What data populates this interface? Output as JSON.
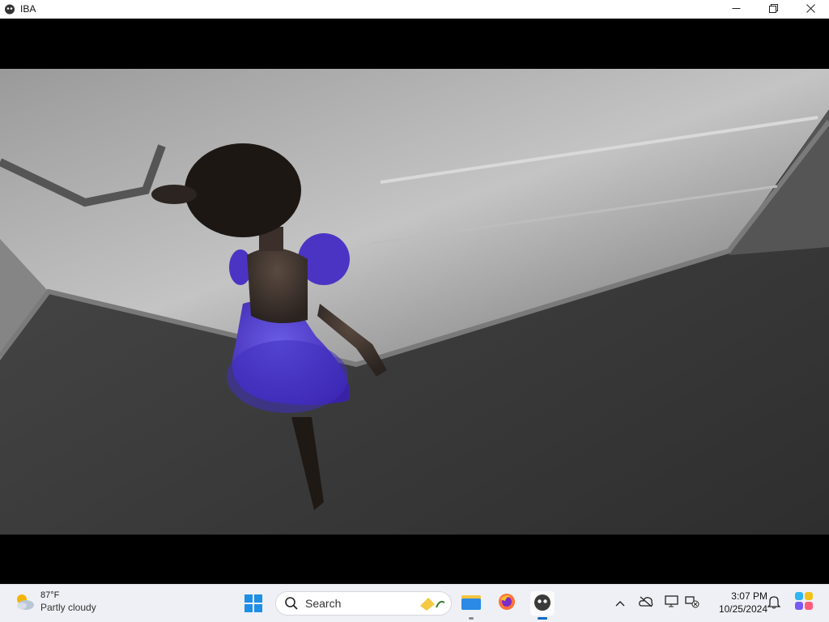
{
  "window": {
    "title": "IBA",
    "icon": "blob-face-icon",
    "controls": [
      "minimize-icon",
      "restore-icon",
      "close-icon"
    ]
  },
  "game": {
    "scene": "3D character in purple dress standing in grey room corner"
  },
  "taskbar": {
    "weather": {
      "temp": "87°F",
      "desc": "Partly cloudy",
      "icon": "partly-cloudy-icon"
    },
    "search": {
      "label": "Search"
    },
    "apps": [
      "file-explorer-icon",
      "firefox-icon",
      "iba-game-icon"
    ],
    "tray": [
      "chevron-up-icon",
      "cloud-off-icon",
      "display-icon",
      "network-off-icon"
    ],
    "clock": {
      "time": "3:07 PM",
      "date": "10/25/2024"
    },
    "colors": {
      "accent": "#0067c0"
    }
  }
}
